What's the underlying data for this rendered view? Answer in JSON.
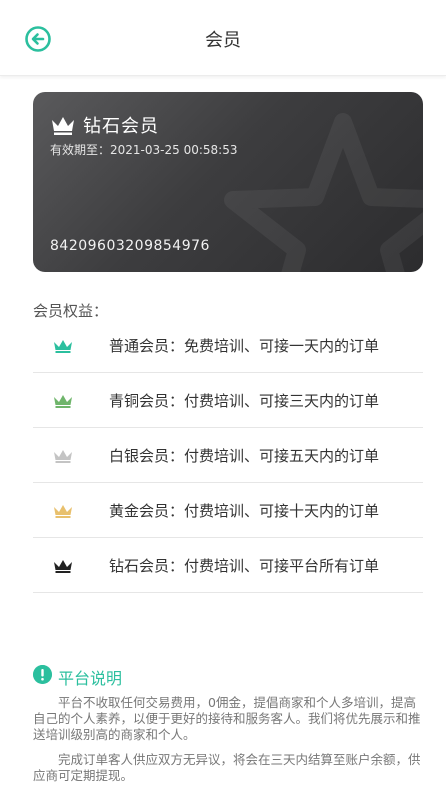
{
  "header": {
    "title": "会员"
  },
  "card": {
    "level": "钻石会员",
    "expiry_label": "有效期至：",
    "expiry_value": "2021-03-25 00:58:53",
    "number": "84209603209854976"
  },
  "rights": {
    "title": "会员权益：",
    "items": [
      {
        "label": "普通会员：免费培训、可接一天内的订单",
        "color": "#2bbf9e"
      },
      {
        "label": "青铜会员：付费培训、可接三天内的订单",
        "color": "#6fb56b"
      },
      {
        "label": "白银会员：付费培训、可接五天内的订单",
        "color": "#c4c4c4"
      },
      {
        "label": "黄金会员：付费培训、可接十天内的订单",
        "color": "#e8c06d"
      },
      {
        "label": "钻石会员：付费培训、可接平台所有订单",
        "color": "#222222"
      }
    ]
  },
  "notice": {
    "title": "平台说明",
    "paragraph1": "平台不收取任何交易费用，0佣金，提倡商家和个人多培训，提高自己的个人素养，以便于更好的接待和服务客人。我们将优先展示和推送培训级别高的商家和个人。",
    "paragraph2": "完成订单客人供应双方无异议，将会在三天内结算至账户余额，供应商可定期提现。"
  },
  "colors": {
    "accent": "#2bbf9e",
    "card_dark": "#2c2c2e"
  },
  "icons": {
    "back": "back-arrow-circle-icon",
    "crown": "crown-icon",
    "info": "exclamation-icon"
  }
}
